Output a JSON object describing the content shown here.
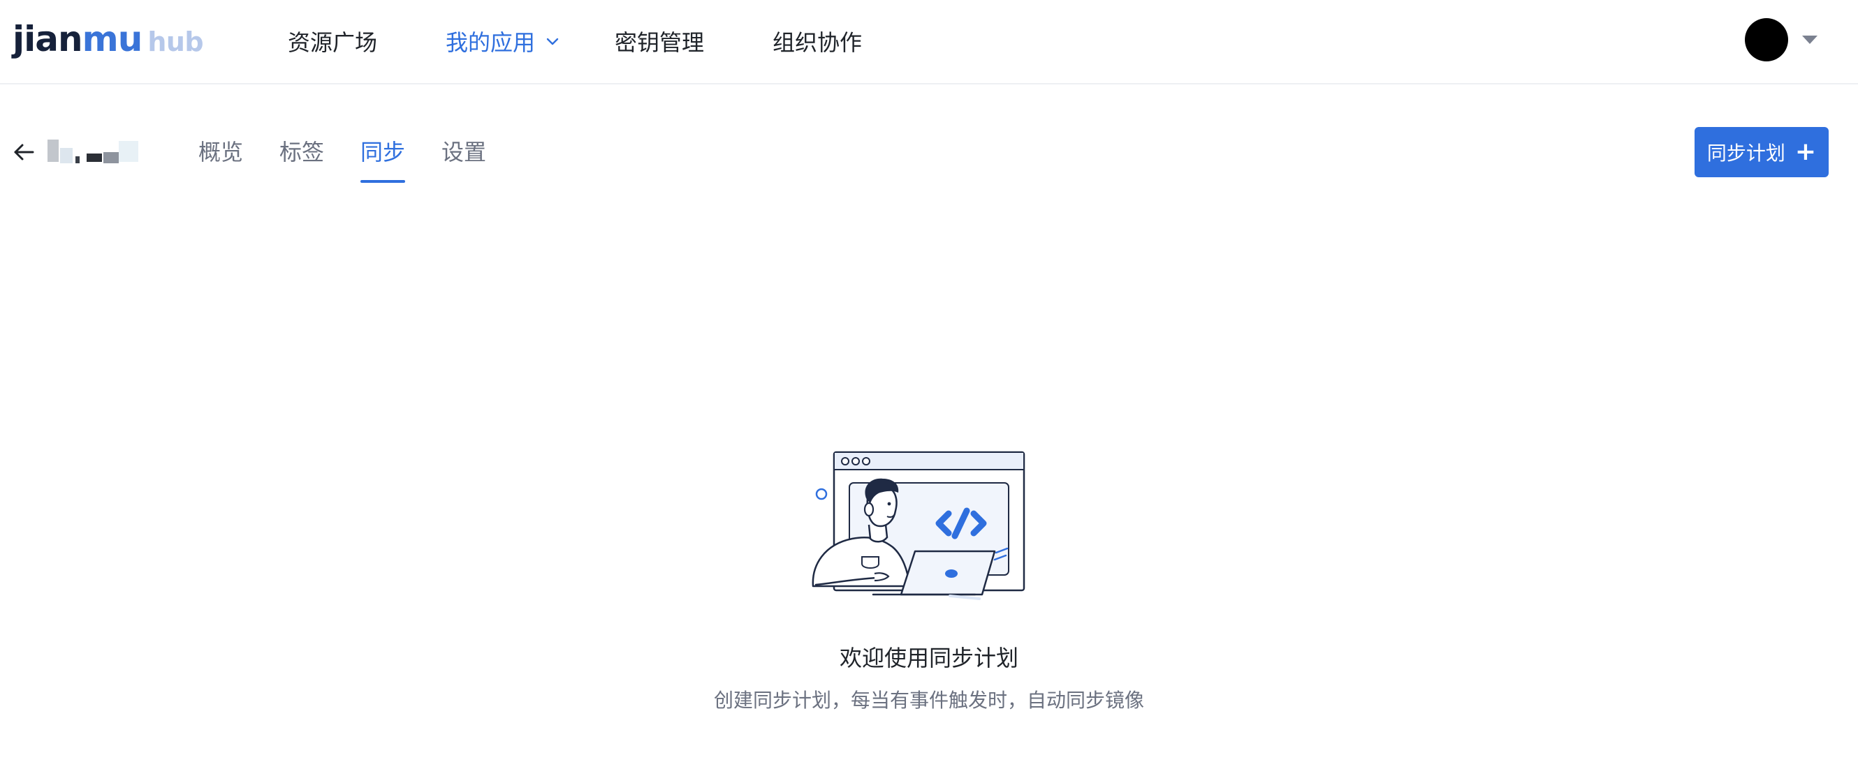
{
  "header": {
    "logo_main_a": "jian",
    "logo_main_b": "mu",
    "logo_sub": "hub",
    "nav": [
      {
        "label": "资源广场"
      },
      {
        "label": "我的应用",
        "active": true
      },
      {
        "label": "密钥管理"
      },
      {
        "label": "组织协作"
      }
    ]
  },
  "subheader": {
    "tabs": [
      {
        "label": "概览"
      },
      {
        "label": "标签"
      },
      {
        "label": "同步",
        "active": true
      },
      {
        "label": "设置"
      }
    ],
    "primary_button": "同步计划",
    "primary_button_icon": "plus-icon"
  },
  "empty_state": {
    "title": "欢迎使用同步计划",
    "description": "创建同步计划，每当有事件触发时，自动同步镜像"
  },
  "colors": {
    "accent": "#2f6fde",
    "text_primary": "#1f2329",
    "text_secondary": "#6b7180",
    "logo_dark": "#16213a"
  }
}
